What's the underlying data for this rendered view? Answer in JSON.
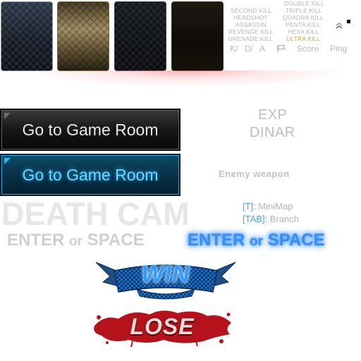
{
  "textures": [
    {
      "name": "blue-carbon"
    },
    {
      "name": "gold-carbon"
    },
    {
      "name": "dark-carbon"
    },
    {
      "name": "dark-brown"
    }
  ],
  "kill_messages": {
    "left": [
      "SECOND KILL",
      "HEADSHOT",
      "ASSASSIN",
      "REVENGE KILL",
      "GRENADE KILL"
    ],
    "right": [
      "DOUBLE KILL",
      "TRIPLE KILL",
      "QUADRA KILL",
      "PENTA KILL",
      "HEXA KILL",
      "ULTRA KILL"
    ]
  },
  "score_header": {
    "k": "K/",
    "d": "D/",
    "a": "A",
    "score": "Score",
    "ping": "Ping"
  },
  "buttons": {
    "normal_label": "Go to Game Room",
    "hover_label": "Go to Game Room"
  },
  "labels": {
    "exp": "EXP",
    "dinar": "DINAR",
    "enemy_weapon": "Enemy weapon",
    "death_cam": "DEATH CAM",
    "enter_a": "ENTER",
    "or": "or",
    "enter_b": "SPACE",
    "minimap_key": "[T]:",
    "minimap_label": "MiniMap",
    "branch_key": "[TAB]:",
    "branch_label": "Branch",
    "win": "WIN",
    "lose": "LOSE"
  },
  "colors": {
    "blue_glow": "#3a8cf0",
    "gold": "#c9a63c",
    "lose_red": "#b5121b"
  }
}
